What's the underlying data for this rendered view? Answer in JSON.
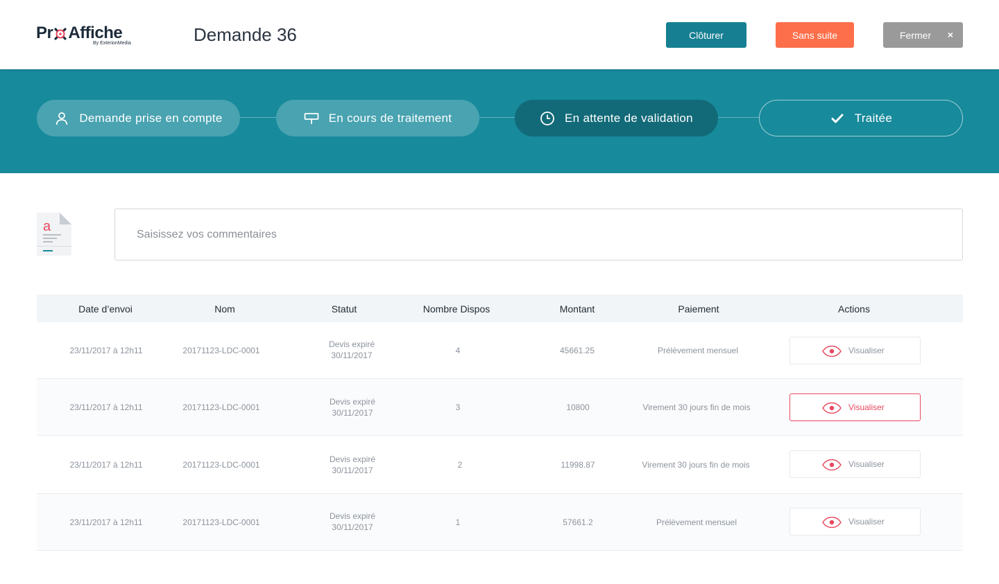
{
  "header": {
    "logo_text_1": "Pr",
    "logo_text_2": "Affiche",
    "logo_sub": "By ExterionMedia",
    "title": "Demande 36",
    "btn_cloturer": "Clôturer",
    "btn_sans_suite": "Sans suite",
    "btn_fermer": "Fermer",
    "btn_fermer_x": "×"
  },
  "steps": [
    {
      "label": "Demande prise en compte",
      "icon": "user-icon"
    },
    {
      "label": "En cours de traitement",
      "icon": "billboard-icon"
    },
    {
      "label": "En attente de validation",
      "icon": "clock-icon"
    },
    {
      "label": "Traitée",
      "icon": "check-icon"
    }
  ],
  "comment": {
    "placeholder": "Saisissez vos commentaires"
  },
  "table": {
    "headers": [
      "Date d’envoi",
      "Nom",
      "Statut",
      "Nombre Dispos",
      "Montant",
      "Paiement",
      "Actions"
    ],
    "rows": [
      {
        "date": "23/11/2017 à 12h11",
        "nom": "20171123-LDC-0001",
        "statut_1": "Devis expiré",
        "statut_2": "30/11/2017",
        "dispos": "4",
        "montant": "45661.25",
        "paiement": "Prélèvement mensuel",
        "action": "Visualiser"
      },
      {
        "date": "23/11/2017 à 12h11",
        "nom": "20171123-LDC-0001",
        "statut_1": "Devis expiré",
        "statut_2": "30/11/2017",
        "dispos": "3",
        "montant": "10800",
        "paiement": "Virement 30 jours fin de mois",
        "action": "Visualiser"
      },
      {
        "date": "23/11/2017 à 12h11",
        "nom": "20171123-LDC-0001",
        "statut_1": "Devis expiré",
        "statut_2": "30/11/2017",
        "dispos": "2",
        "montant": "11998.87",
        "paiement": "Virement 30 jours fin de mois",
        "action": "Visualiser"
      },
      {
        "date": "23/11/2017 à 12h11",
        "nom": "20171123-LDC-0001",
        "statut_1": "Devis expiré",
        "statut_2": "30/11/2017",
        "dispos": "1",
        "montant": "57661.2",
        "paiement": "Prélèvement mensuel",
        "action": "Visualiser"
      }
    ]
  },
  "colors": {
    "teal": "#178a9b",
    "teal_dark": "#126a78",
    "orange": "#fd6f4a",
    "grey": "#9a9a9a",
    "pink": "#e8485f"
  }
}
